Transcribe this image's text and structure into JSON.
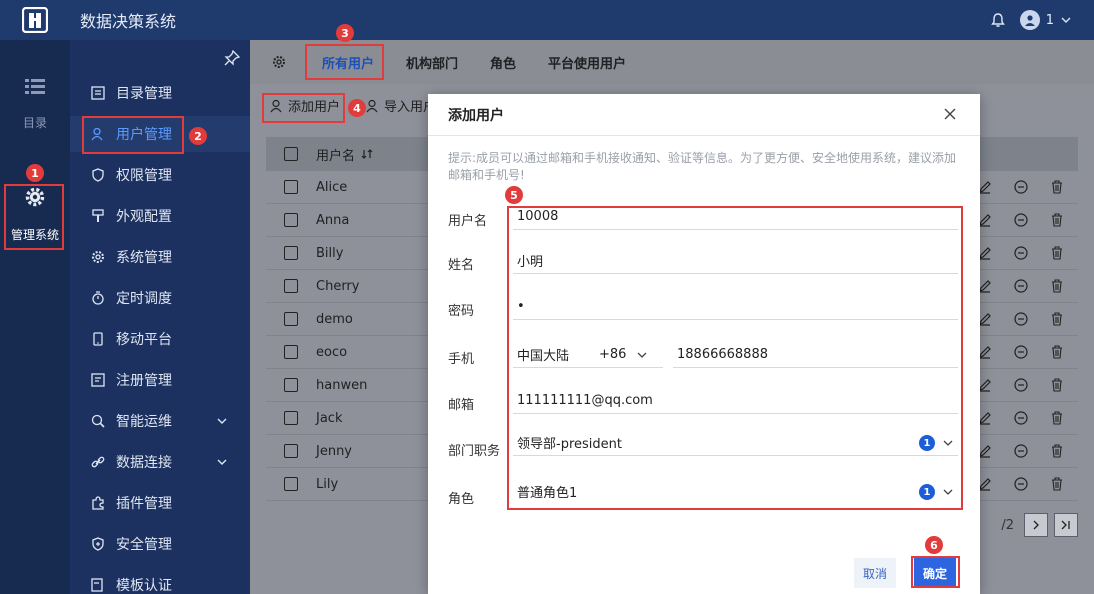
{
  "app": {
    "title": "数据决策系统",
    "user_name": "1"
  },
  "rail": {
    "catalog_label": "目录",
    "admin_label": "管理系统"
  },
  "sidebar": {
    "items": [
      {
        "label": "目录管理"
      },
      {
        "label": "用户管理"
      },
      {
        "label": "权限管理"
      },
      {
        "label": "外观配置"
      },
      {
        "label": "系统管理"
      },
      {
        "label": "定时调度"
      },
      {
        "label": "移动平台"
      },
      {
        "label": "注册管理"
      },
      {
        "label": "智能运维"
      },
      {
        "label": "数据连接"
      },
      {
        "label": "插件管理"
      },
      {
        "label": "安全管理"
      },
      {
        "label": "模板认证"
      }
    ]
  },
  "tabs": [
    {
      "label": "所有用户"
    },
    {
      "label": "机构部门"
    },
    {
      "label": "角色"
    },
    {
      "label": "平台使用用户"
    }
  ],
  "toolbar": {
    "add_user": "添加用户",
    "import_user": "导入用户"
  },
  "table": {
    "header_username": "用户名",
    "rows": [
      "Alice",
      "Anna",
      "Billy",
      "Cherry",
      "demo",
      "eoco",
      "hanwen",
      "Jack",
      "Jenny",
      "Lily"
    ]
  },
  "pager": {
    "pages": "/2"
  },
  "dialog": {
    "title": "添加用户",
    "hint": "提示:成员可以通过邮箱和手机接收通知、验证等信息。为了更方便、安全地使用系统，建议添加邮箱和手机号!",
    "username_label": "用户名",
    "username_value": "10008",
    "realname_label": "姓名",
    "realname_value": "小明",
    "password_label": "密码",
    "password_value": "•",
    "phone_label": "手机",
    "phone_region": "中国大陆",
    "phone_code": "+86",
    "phone_value": "18866668888",
    "email_label": "邮箱",
    "email_value": "111111111@qq.com",
    "dept_label": "部门职务",
    "dept_value": "领导部-president",
    "dept_count": "1",
    "role_label": "角色",
    "role_value": "普通角色1",
    "role_count": "1",
    "cancel": "取消",
    "ok": "确定"
  },
  "annotations": [
    "1",
    "2",
    "3",
    "4",
    "5",
    "6"
  ],
  "colors": {
    "topbar": "#1f3a6d",
    "annotation": "#e23b3b",
    "primary": "#2d65e0"
  }
}
